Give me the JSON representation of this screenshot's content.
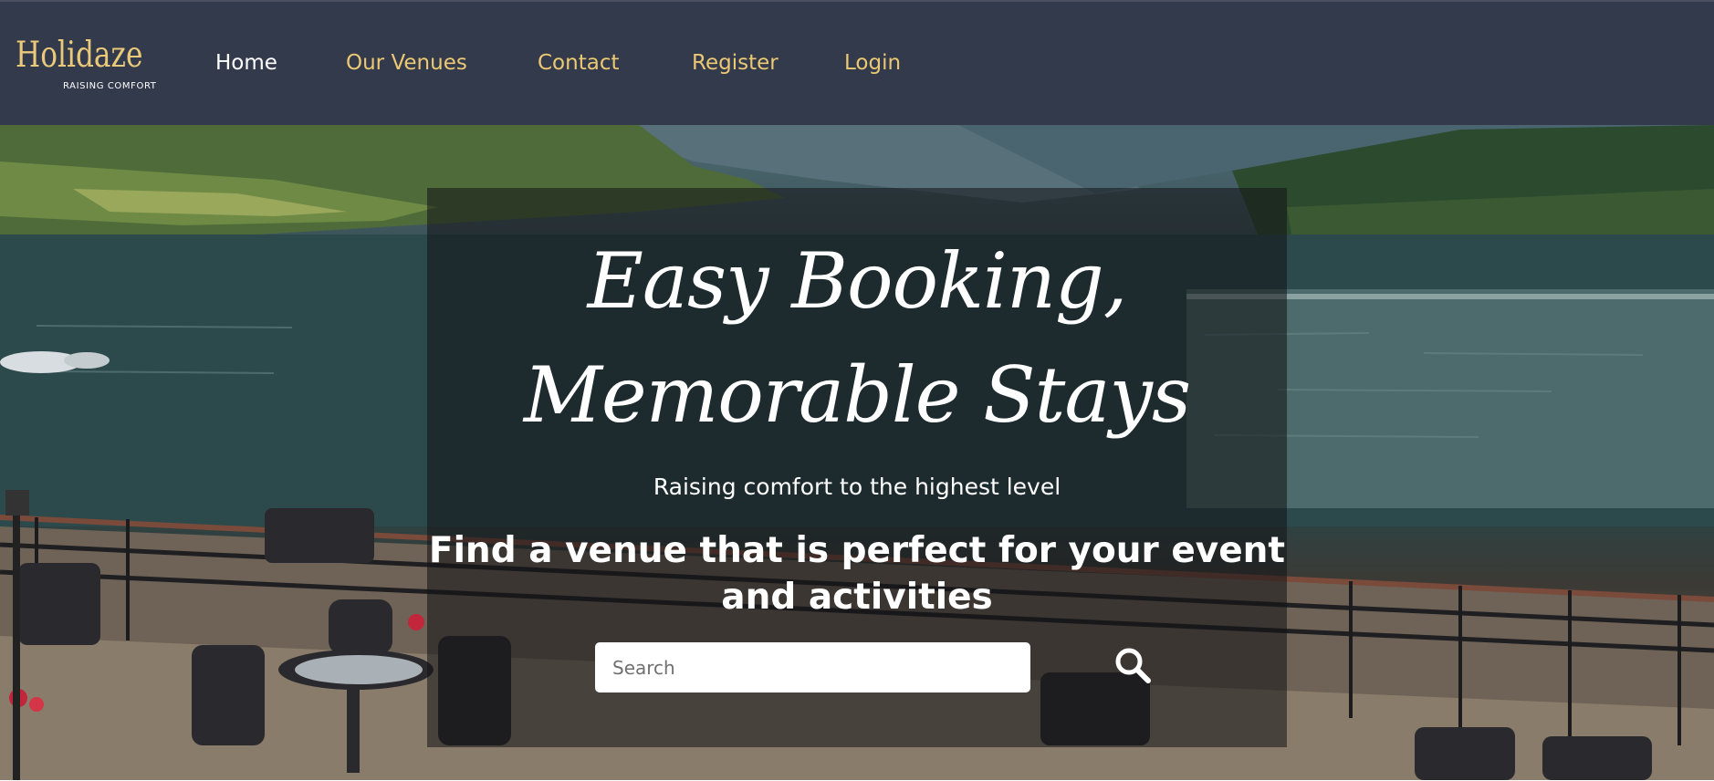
{
  "brand": {
    "name": "Holidaze",
    "tagline": "RAISING COMFORT",
    "colors": {
      "navbar": "#333a4b",
      "accent": "#ebc873",
      "active": "#ffffff"
    }
  },
  "nav": {
    "items": [
      {
        "label": "Home",
        "active": true
      },
      {
        "label": "Our Venues",
        "active": false
      },
      {
        "label": "Contact",
        "active": false
      },
      {
        "label": "Register",
        "active": false
      },
      {
        "label": "Login",
        "active": false
      }
    ]
  },
  "hero": {
    "headline_line1": "Easy Booking,",
    "headline_line2": "Memorable Stays",
    "subtitle": "Raising comfort to the highest level",
    "find_text": "Find a venue that is perfect for your event and activities",
    "search": {
      "placeholder": "Search",
      "value": "",
      "icon": "search-icon"
    }
  }
}
